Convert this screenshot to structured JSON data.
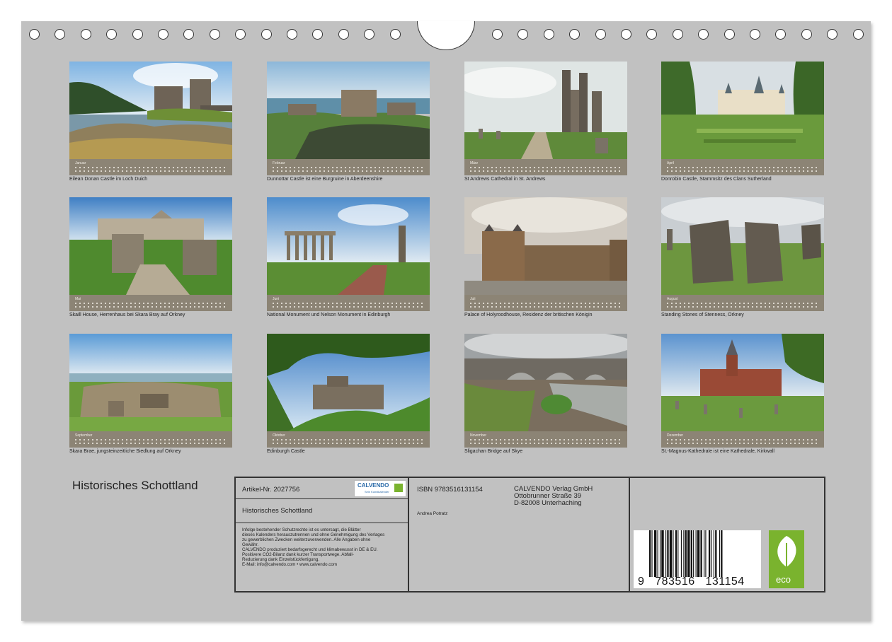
{
  "calendar": {
    "title": "Historisches Schottland",
    "months": [
      {
        "month": "Januar",
        "caption": "Eilean Donan Castle im Loch Duich"
      },
      {
        "month": "Februar",
        "caption": "Dunnottar Castle ist eine Burgruine in Aberdeenshire"
      },
      {
        "month": "März",
        "caption": "St Andrews Cathedral in St. Andrews"
      },
      {
        "month": "April",
        "caption": "Donrobin Castle, Stammsitz des Clans Sutherland"
      },
      {
        "month": "Mai",
        "caption": "Skaill House, Herrenhaus bei Skara Bray auf Orkney"
      },
      {
        "month": "Juni",
        "caption": "National Monument und Nelson Monument in Edinburgh"
      },
      {
        "month": "Juli",
        "caption": "Palace of Holyroodhouse, Residenz der britischen Königin"
      },
      {
        "month": "August",
        "caption": "Standing Stones of Stenness, Orkney"
      },
      {
        "month": "September",
        "caption": "Skara Brae, jungsteinzeitliche Siedlung auf Orkney"
      },
      {
        "month": "Oktober",
        "caption": "Edinburgh Castle"
      },
      {
        "month": "November",
        "caption": "Sligachan Bridge auf Skye"
      },
      {
        "month": "Dezember",
        "caption": "St.-Magnus-Kathedrale ist eine Kathedrale, Kirkwall"
      }
    ]
  },
  "info": {
    "artikel": "Artikel-Nr. 2027756",
    "product_title": "Historisches Schottland",
    "brand": "CALVENDO",
    "brand_sub": "Sein Kunstkalender",
    "isbn": "ISBN 9783516131154",
    "author": "Andrea Potratz",
    "publisher_lines": [
      "CALVENDO Verlag GmbH",
      "Ottobrunner Straße 39",
      "D-82008 Unterhaching"
    ],
    "legal_lines": [
      "Infolge bestehender Schutzrechte ist es untersagt, die Blätter",
      "dieses Kalenders herauszutrennen und ohne Genehmigung des Verlages",
      "zu gewerblichen Zwecken weiterzuverwenden. Alle Angaben ohne",
      "Gewähr.",
      "CALVENDO produziert bedarfsgerecht und klimabewusst in DE & EU.",
      "Positivere CO2-Bilanz dank kurzer Transportwege. Abfall-",
      "Reduzierung dank Einzelstückfertigung.",
      "E-Mail: info@calvendo.com • www.calvendo.com"
    ],
    "barcode_number": "9   783516   131154",
    "eco_label": "eco"
  },
  "colors": {
    "sheet": "#c1c1c1",
    "strip": "#8c8475",
    "brand_green": "#7ab32e"
  }
}
